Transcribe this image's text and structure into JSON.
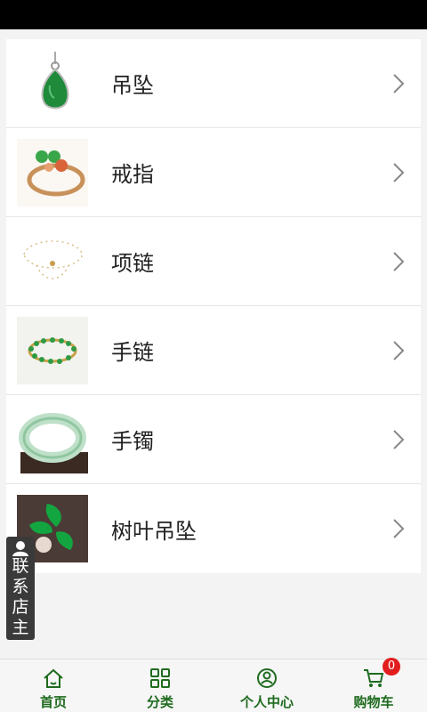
{
  "categories": [
    {
      "label": "吊坠",
      "thumb": "pendant"
    },
    {
      "label": "戒指",
      "thumb": "ring"
    },
    {
      "label": "项链",
      "thumb": "necklace"
    },
    {
      "label": "手链",
      "thumb": "bracelet"
    },
    {
      "label": "手镯",
      "thumb": "bangle"
    },
    {
      "label": "树叶吊坠",
      "thumb": "leaf-pendant"
    }
  ],
  "contact": {
    "label": "联系店主",
    "icon": "person-icon"
  },
  "tabbar": {
    "home": {
      "label": "首页",
      "icon": "home-icon"
    },
    "category": {
      "label": "分类",
      "icon": "grid-icon"
    },
    "profile": {
      "label": "个人中心",
      "icon": "user-circle-icon"
    },
    "cart": {
      "label": "购物车",
      "icon": "cart-icon",
      "badge": "0"
    }
  },
  "colors": {
    "accent": "#1f6b1f",
    "badge": "#e21d1d",
    "jade": "#1e8a3a"
  }
}
